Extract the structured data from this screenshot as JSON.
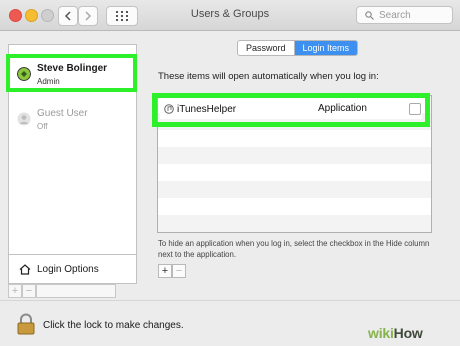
{
  "window": {
    "title": "Users & Groups",
    "search_placeholder": "Search",
    "back_icon": "chevron-left-icon",
    "forward_icon": "chevron-right-icon",
    "grid_icon": "grid-icon"
  },
  "sidebar": {
    "users": [
      {
        "name": "Steve Bolinger",
        "role": "Admin",
        "avatar_color": "#8cc63f"
      },
      {
        "name": "Guest User",
        "role": "Off",
        "avatar_color": "#c9c9c9"
      }
    ],
    "login_options_label": "Login Options",
    "add_label": "+",
    "remove_label": "−"
  },
  "tabs": {
    "password": "Password",
    "login_items": "Login Items",
    "active": "Login Items"
  },
  "login_items": {
    "description": "These items will open automatically when you log in:",
    "rows": [
      {
        "name": "iTunesHelper",
        "kind": "Application",
        "hide": false
      }
    ],
    "hint": "To hide an application when you log in, select the checkbox in the Hide column next to the application.",
    "add_label": "+",
    "remove_label": "−"
  },
  "footer": {
    "lock_text": "Click the lock to make changes."
  },
  "watermark": {
    "part1": "wiki",
    "part2": "How"
  },
  "colors": {
    "highlight": "#2ef02a",
    "accent": "#3d8ff0"
  }
}
